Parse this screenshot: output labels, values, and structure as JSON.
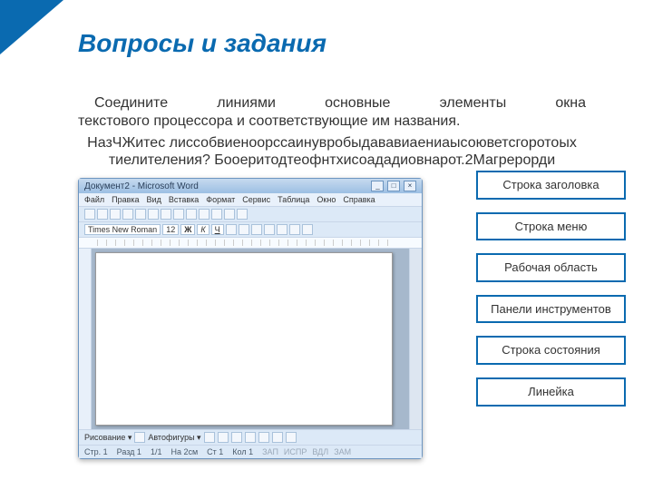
{
  "title": "Вопросы и задания",
  "instruction": {
    "line1_words": [
      "Соедините",
      "линиями",
      "основные",
      "элементы",
      "окна"
    ],
    "line2": "текстового процессора и соответствующие им названия."
  },
  "overlay": {
    "line1": "НазЧЖитес лиссобвиеноорссаинувробыдававиаениаысоюветсгоротоых",
    "line2": "тиелителения? Бооеритодтеофнтхисоададиовнарот.2Магрерорди"
  },
  "word_app": {
    "title": "Документ2 - Microsoft Word",
    "menu": [
      "Файл",
      "Правка",
      "Вид",
      "Вставка",
      "Формат",
      "Сервис",
      "Таблица",
      "Окно",
      "Справка"
    ],
    "font": "Times New Roman",
    "font_size": "12",
    "format_chars": [
      "Ж",
      "К",
      "Ч"
    ],
    "draw_label": "Рисование ▾",
    "autoshapes": "Автофигуры ▾",
    "status": {
      "page": "Стр. 1",
      "section": "Разд 1",
      "pages": "1/1",
      "at": "На 2см",
      "ln": "Ст 1",
      "col": "Кол 1",
      "indicators": [
        "ЗАП",
        "ИСПР",
        "ВДЛ",
        "ЗАМ"
      ]
    }
  },
  "labels": [
    "Строка заголовка",
    "Строка меню",
    "Рабочая область",
    "Панели инструментов",
    "Строка состояния",
    "Линейка"
  ]
}
